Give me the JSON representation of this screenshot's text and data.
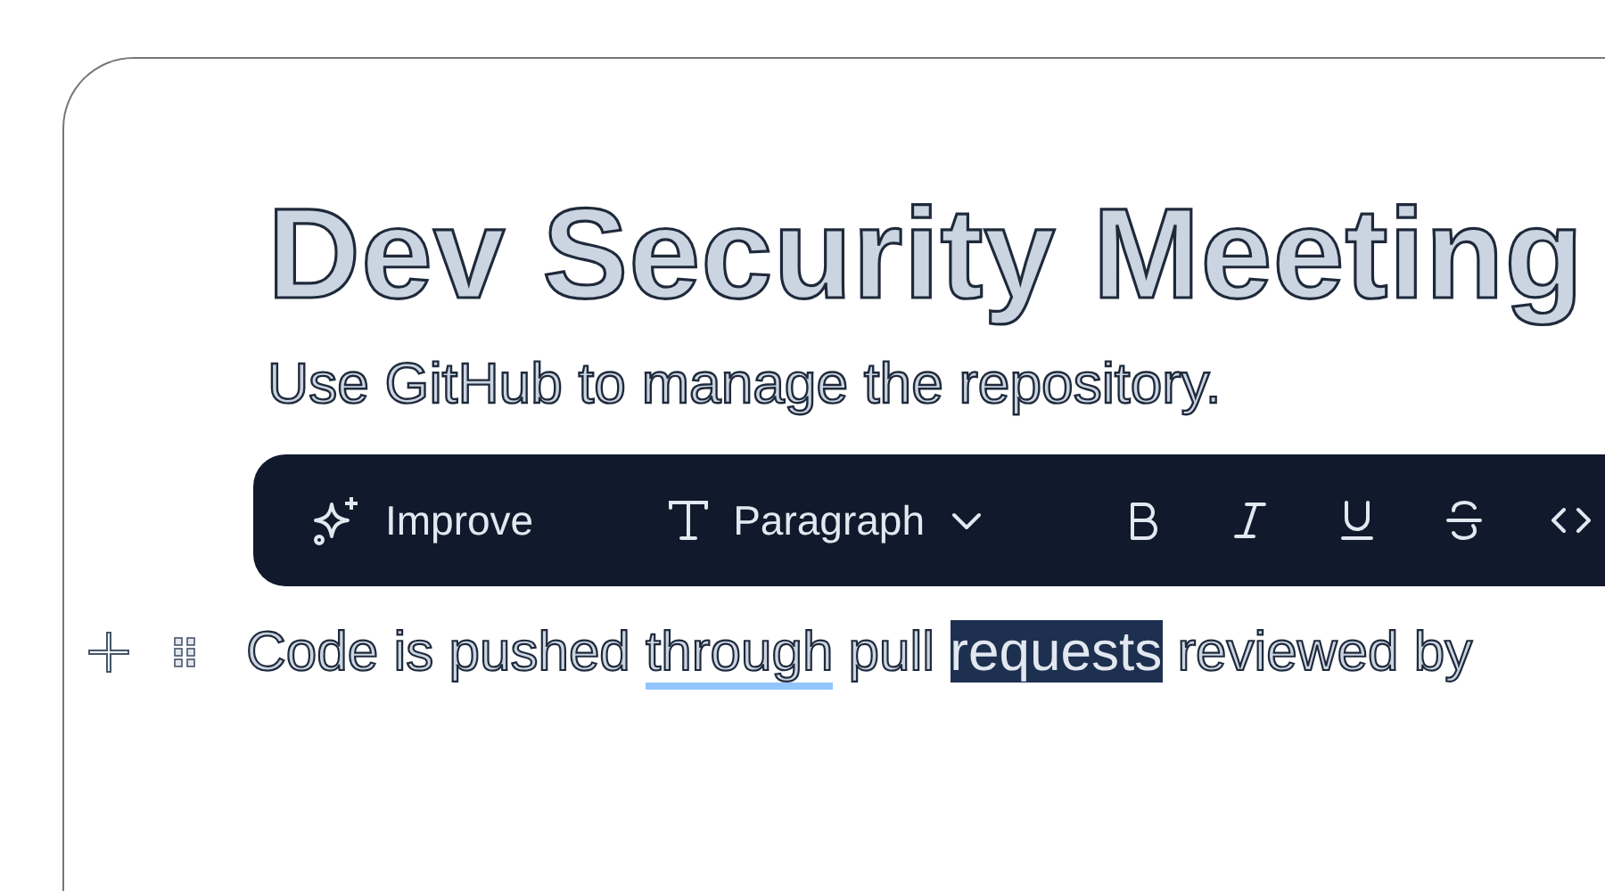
{
  "document": {
    "title": "Dev Security Meeting",
    "subtitle": "Use GitHub to manage the repository."
  },
  "toolbar": {
    "improve": {
      "label": "Improve"
    },
    "block_type": {
      "label": "Paragraph"
    },
    "format_buttons": [
      {
        "kind": "bold",
        "active": false
      },
      {
        "kind": "italic",
        "active": false
      },
      {
        "kind": "underline",
        "active": false
      },
      {
        "kind": "strike",
        "active": false
      },
      {
        "kind": "code",
        "active": false
      }
    ]
  },
  "paragraph": {
    "segments": [
      {
        "text": "Code is pushed ",
        "underlined": false,
        "selected": false
      },
      {
        "text": "through",
        "underlined": true,
        "selected": false
      },
      {
        "text": " pull ",
        "underlined": false,
        "selected": false
      },
      {
        "text": "requests",
        "underlined": false,
        "selected": true
      },
      {
        "text": " reviewed by",
        "underlined": false,
        "selected": false
      }
    ]
  }
}
